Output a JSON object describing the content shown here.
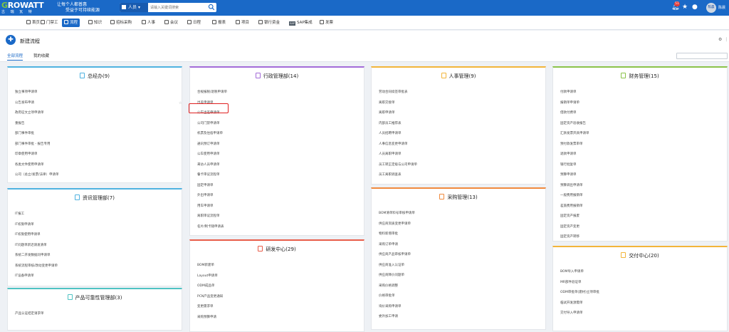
{
  "header": {
    "logo_main": "ROWATT",
    "logo_g": "G",
    "logo_sub": "古 瑞 瓦 特",
    "slogan_1": "让每个人都普惠",
    "slogan_2": "受益于可持续能源",
    "search_category": "人员",
    "search_placeholder": "请输入关键词搜索",
    "notification_count": "51",
    "avatar_text": "陈晨",
    "user_name": "陈晨"
  },
  "menu": [
    {
      "label": "首页",
      "icon": "home-icon"
    },
    {
      "label": "门禁工",
      "icon": "doc-icon"
    },
    {
      "label": "流程",
      "icon": "flow-icon",
      "active": true
    },
    {
      "label": "知识",
      "icon": "book-icon"
    },
    {
      "label": "招标采购",
      "icon": "cart-icon"
    },
    {
      "label": "人事",
      "icon": "person-icon"
    },
    {
      "label": "会议",
      "icon": "meeting-icon"
    },
    {
      "label": "日程",
      "icon": "calendar-icon"
    },
    {
      "label": "报表",
      "icon": "report-icon"
    },
    {
      "label": "项目",
      "icon": "project-icon"
    },
    {
      "label": "银行资金",
      "icon": "bank-icon"
    },
    {
      "label": "SAP集成",
      "icon": "sap-icon"
    },
    {
      "label": "发票",
      "icon": "invoice-icon"
    }
  ],
  "page": {
    "title": "新建流程",
    "tabs": [
      {
        "label": "全部流程",
        "active": true
      },
      {
        "label": "我的收藏",
        "active": false
      }
    ]
  },
  "cards": [
    {
      "title": "总经办(9)",
      "color": "#4fb2e0",
      "items": [
        "独立事项申请单",
        "公告发布申请",
        "政府征文立项申请单",
        "重报告",
        "部门事件审批",
        "部门事件审批 - 报告专用",
        "印章使用申请单",
        "各类文件使用申请单",
        "公司（总立/发票/法律）申请单"
      ]
    },
    {
      "title": "资讯管理部(7)",
      "color": "#4fb2e0",
      "items": [
        "IT报工",
        "IT权限申请单",
        "IT权限使用申请单",
        "IT问题单新近请发清单",
        "系统二开发数据问申请单",
        "系统流程审核/改动变更申请单",
        "IT设备申请单"
      ]
    },
    {
      "title": "产品可靠性管理部(3)",
      "color": "#4fc3c3",
      "items": [
        "产品认证结定请求单"
      ]
    },
    {
      "title": "行政管理部(14)",
      "color": "#a36bd8",
      "items": [
        "合规报税/退税申请单",
        "出差申请单",
        "公车出差申请单",
        "公司门禁申请单",
        "机票及住宿申请单",
        "通讯预订申请单",
        "公车使用申请单",
        "来访人员申请单",
        "餐卡审议流程单",
        "固定申请单",
        "外出申请单",
        "用车申请单",
        "离职审议流程单",
        "名片/制卡随申请表"
      ]
    },
    {
      "title": "研发中心(29)",
      "color": "#e85d4a",
      "items": [
        "BOM新建单",
        "Layout申请单",
        "ODM成品单",
        "PCN产品变更通知",
        "变更需求单",
        "采购预算申请"
      ]
    },
    {
      "title": "人事管理(9)",
      "color": "#f2b53a",
      "items": [
        "劳动合同续签审批表",
        "离职交接单",
        "离职申请单",
        "内部员工推荐表",
        "人员招聘申请单",
        "人事信息变更申请单",
        "人员离职申请单",
        "员工转正定级与公司申请单",
        "员工离职调查表"
      ]
    },
    {
      "title": "采购管理(13)",
      "color": "#f08a3e",
      "items": [
        "BOM清单料号审核申请单",
        "供应商资质变更申请单",
        "物料新增审批",
        "采购订单申请",
        "供应商产品审核申请单",
        "供应商准入认证单",
        "供应商降价问题单",
        "采购价格调整",
        "价格审批单",
        "询价采购申请单",
        "委外加工申请"
      ]
    },
    {
      "title": "财务管理(15)",
      "color": "#8bc34a",
      "items": [
        "付款申请单",
        "报销单申请单",
        "借款付费单",
        "固定资产验收报告",
        "汇款发票开具申请单",
        "预付款发票审单",
        "退款申请单",
        "银行批复单",
        "预算申请单",
        "预算调出申请单",
        "一般费用报销单",
        "差旅费用报销单",
        "固定资产报废",
        "固定资产变更",
        "固定资产转移"
      ]
    },
    {
      "title": "交付中心(20)",
      "color": "#f2b53a",
      "items": [
        "BOM导入申请单",
        "MR部件验证单",
        "ODM审批单(建材)立项审批",
        "临试开发源需单",
        "交付导入申请单"
      ]
    }
  ]
}
